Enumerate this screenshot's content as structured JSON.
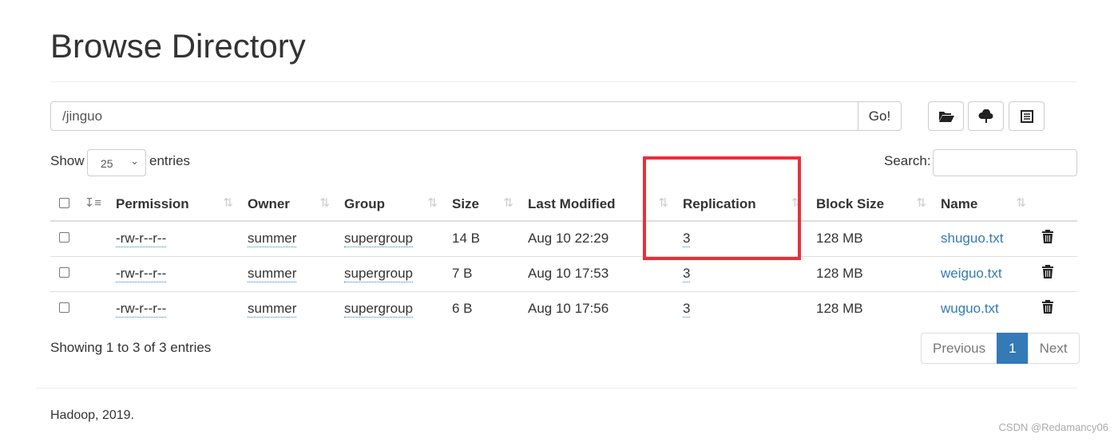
{
  "title": "Browse Directory",
  "path": {
    "value": "/jinguo",
    "go_label": "Go!"
  },
  "toolbar": [
    {
      "icon": "folder-open-icon"
    },
    {
      "icon": "cloud-upload-icon"
    },
    {
      "icon": "list-icon"
    }
  ],
  "length": {
    "show": "Show",
    "value": "25",
    "entries": "entries"
  },
  "search": {
    "label": "Search:",
    "value": ""
  },
  "columns": [
    "Permission",
    "Owner",
    "Group",
    "Size",
    "Last Modified",
    "Replication",
    "Block Size",
    "Name"
  ],
  "rows": [
    {
      "permission": "-rw-r--r--",
      "owner": "summer",
      "group": "supergroup",
      "size": "14 B",
      "modified": "Aug 10 22:29",
      "replication": "3",
      "block_size": "128 MB",
      "name": "shuguo.txt"
    },
    {
      "permission": "-rw-r--r--",
      "owner": "summer",
      "group": "supergroup",
      "size": "7 B",
      "modified": "Aug 10 17:53",
      "replication": "3",
      "block_size": "128 MB",
      "name": "weiguo.txt"
    },
    {
      "permission": "-rw-r--r--",
      "owner": "summer",
      "group": "supergroup",
      "size": "6 B",
      "modified": "Aug 10 17:56",
      "replication": "3",
      "block_size": "128 MB",
      "name": "wuguo.txt"
    }
  ],
  "info": "Showing 1 to 3 of 3 entries",
  "pagination": {
    "previous": "Previous",
    "current": "1",
    "next": "Next"
  },
  "footer": "Hadoop, 2019.",
  "watermark": "CSDN @Redamancy06",
  "highlight_color": "#e8303a"
}
